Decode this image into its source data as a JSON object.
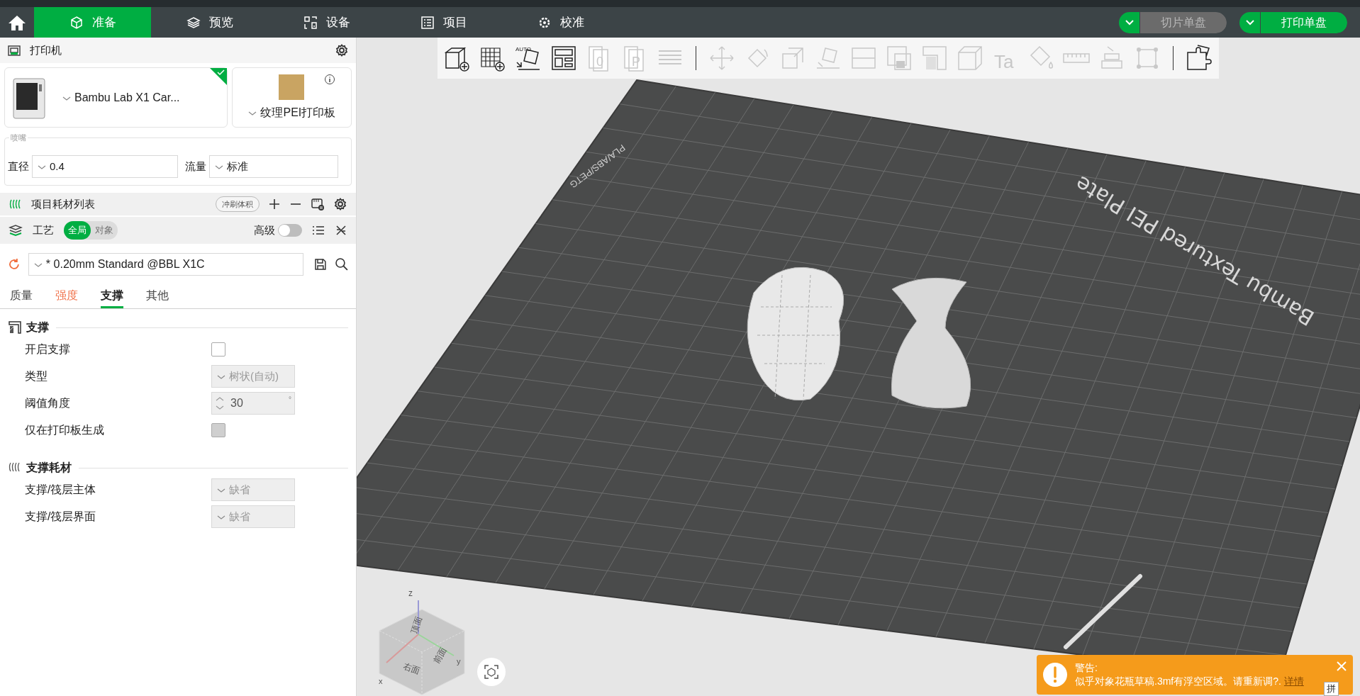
{
  "nav": {
    "tabs": [
      {
        "label": "准备",
        "selected": true
      },
      {
        "label": "预览",
        "selected": false
      },
      {
        "label": "设备",
        "selected": false
      },
      {
        "label": "项目",
        "selected": false
      },
      {
        "label": "校准",
        "selected": false
      }
    ]
  },
  "actions": [
    {
      "label": "切片单盘",
      "disabled": true
    },
    {
      "label": "打印单盘",
      "disabled": false
    }
  ],
  "toolbar": [
    {
      "kind": "tool",
      "disabled": false
    },
    {
      "kind": "tool",
      "disabled": false
    },
    {
      "kind": "tool",
      "disabled": false,
      "label": "AUTO"
    },
    {
      "kind": "tool",
      "disabled": false
    },
    {
      "kind": "tool",
      "disabled": true,
      "label": "0"
    },
    {
      "kind": "tool",
      "disabled": true,
      "label": "P"
    },
    {
      "kind": "tool",
      "disabled": true
    },
    {
      "kind": "separator"
    },
    {
      "kind": "tool",
      "disabled": true
    },
    {
      "kind": "tool",
      "disabled": true
    },
    {
      "kind": "tool",
      "disabled": true
    },
    {
      "kind": "tool",
      "disabled": true
    },
    {
      "kind": "tool",
      "disabled": true
    },
    {
      "kind": "tool",
      "disabled": true
    },
    {
      "kind": "tool",
      "disabled": true
    },
    {
      "kind": "tool",
      "disabled": true
    },
    {
      "kind": "tool",
      "disabled": true,
      "label": "Ta"
    },
    {
      "kind": "tool",
      "disabled": true
    },
    {
      "kind": "tool",
      "disabled": true
    },
    {
      "kind": "tool",
      "disabled": true
    },
    {
      "kind": "tool",
      "disabled": true
    },
    {
      "kind": "separator"
    },
    {
      "kind": "tool",
      "disabled": false
    }
  ],
  "printer": {
    "title": "打印机",
    "name": "Bambu Lab X1 Car...",
    "selected": true,
    "plate": "纹理PEI打印板"
  },
  "nozzle": {
    "legend": "喷嘴",
    "diameter_label": "直径",
    "diameter": "0.4",
    "flow_label": "流量",
    "flow": "标准"
  },
  "filament": {
    "title": "项目耗材列表",
    "flush_button": "冲刷体积"
  },
  "process": {
    "title": "工艺",
    "scope": [
      {
        "label": "全局",
        "selected": true
      },
      {
        "label": "对象",
        "selected": false
      }
    ],
    "advanced_label": "高级",
    "advanced": false,
    "preset": "* 0.20mm Standard @BBL X1C",
    "tabs": [
      {
        "label": "质量",
        "selected": false,
        "modified": false
      },
      {
        "label": "强度",
        "selected": false,
        "modified": true
      },
      {
        "label": "支撑",
        "selected": true,
        "modified": false
      },
      {
        "label": "其他",
        "selected": false,
        "modified": false
      }
    ]
  },
  "sections": [
    {
      "title": "支撑",
      "rows": [
        {
          "kind": "checkbox",
          "label": "开启支撑",
          "checked": false,
          "disabled": false
        },
        {
          "kind": "dropdown",
          "label": "类型",
          "value": "树状(自动)",
          "disabled": true
        },
        {
          "kind": "spin",
          "label": "阈值角度",
          "value": "30",
          "unit": "°",
          "disabled": true
        },
        {
          "kind": "checkbox",
          "label": "仅在打印板生成",
          "checked": false,
          "disabled": true
        }
      ]
    },
    {
      "title": "支撑耗材",
      "rows": [
        {
          "kind": "dropdown",
          "label": "支撑/筏层主体",
          "value": "缺省",
          "disabled": true
        },
        {
          "kind": "dropdown",
          "label": "支撑/筏层界面",
          "value": "缺省",
          "disabled": true
        }
      ]
    }
  ],
  "viewport": {
    "plate_label": "Bambu Textured PEI Plate",
    "plate_filaments": "PLA/ABS/PETG",
    "view_cube": {
      "top": "顶面",
      "right": "右面",
      "front": "前面",
      "x": "x",
      "y": "y",
      "z": "z"
    }
  },
  "warning": {
    "title": "警告:",
    "message": "似乎对象花瓶草稿.3mf有浮空区域。请重新调?.",
    "link": "详情"
  },
  "corner_badge": "拼"
}
